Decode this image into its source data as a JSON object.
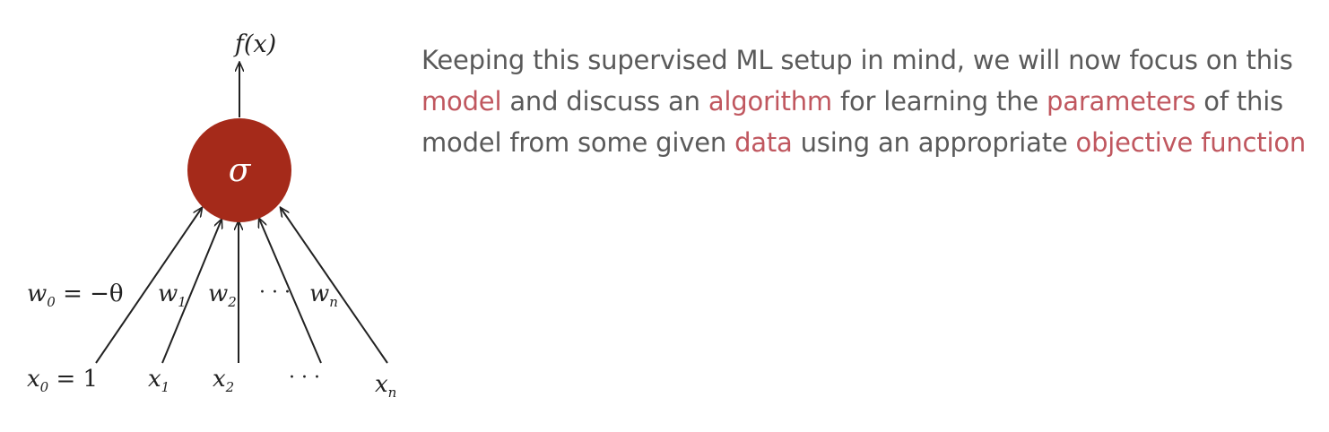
{
  "diagram": {
    "output_label": "f(x)",
    "node_symbol": "σ",
    "node_color": "#a52a1a",
    "weights": {
      "w0_lhs": "w",
      "w0_sub": "0",
      "w0_rhs": " = −θ",
      "w1": "w",
      "w1_sub": "1",
      "w2": "w",
      "w2_sub": "2",
      "dots": "· · ·",
      "wn": "w",
      "wn_sub": "n"
    },
    "inputs": {
      "x0_var": "x",
      "x0_sub": "0",
      "x0_rhs": " = 1",
      "x1_var": "x",
      "x1_sub": "1",
      "x2_var": "x",
      "x2_sub": "2",
      "dots": "· · ·",
      "xn_var": "x",
      "xn_sub": "n"
    }
  },
  "text": {
    "s1": "Keeping this supervised ML setup in mind, we will now focus on this ",
    "h1": "model",
    "s2": " and discuss an ",
    "h2": "algorithm",
    "s3": " for learning the ",
    "h3": "parameters",
    "s4": " of this model from some given ",
    "h4": "data",
    "s5": " using an appropriate ",
    "h5": "objective function"
  },
  "colors": {
    "highlight": "#c0575f",
    "body_text": "#5a5a5a"
  }
}
